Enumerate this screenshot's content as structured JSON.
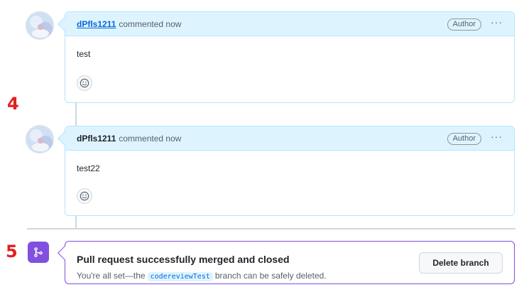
{
  "comments": [
    {
      "author": "dPfls1211",
      "meta": "commented now",
      "badge": "Author",
      "menu": "···",
      "body": "test",
      "author_linked": true
    },
    {
      "author": "dPfls1211",
      "meta": "commented now",
      "badge": "Author",
      "menu": "···",
      "body": "test22",
      "author_linked": false
    }
  ],
  "annotations": {
    "step4": "4",
    "step5": "5"
  },
  "merge": {
    "title": "Pull request successfully merged and closed",
    "desc_prefix": "You're all set—the",
    "branch": "codereviewTest",
    "desc_suffix": "branch can be safely deleted.",
    "delete_button": "Delete branch",
    "icon": "git-merge-icon"
  },
  "colors": {
    "accent_blue": "#0969da",
    "header_bg": "#ddf4ff",
    "merged_purple": "#8250df",
    "marker_red": "#e02020"
  }
}
